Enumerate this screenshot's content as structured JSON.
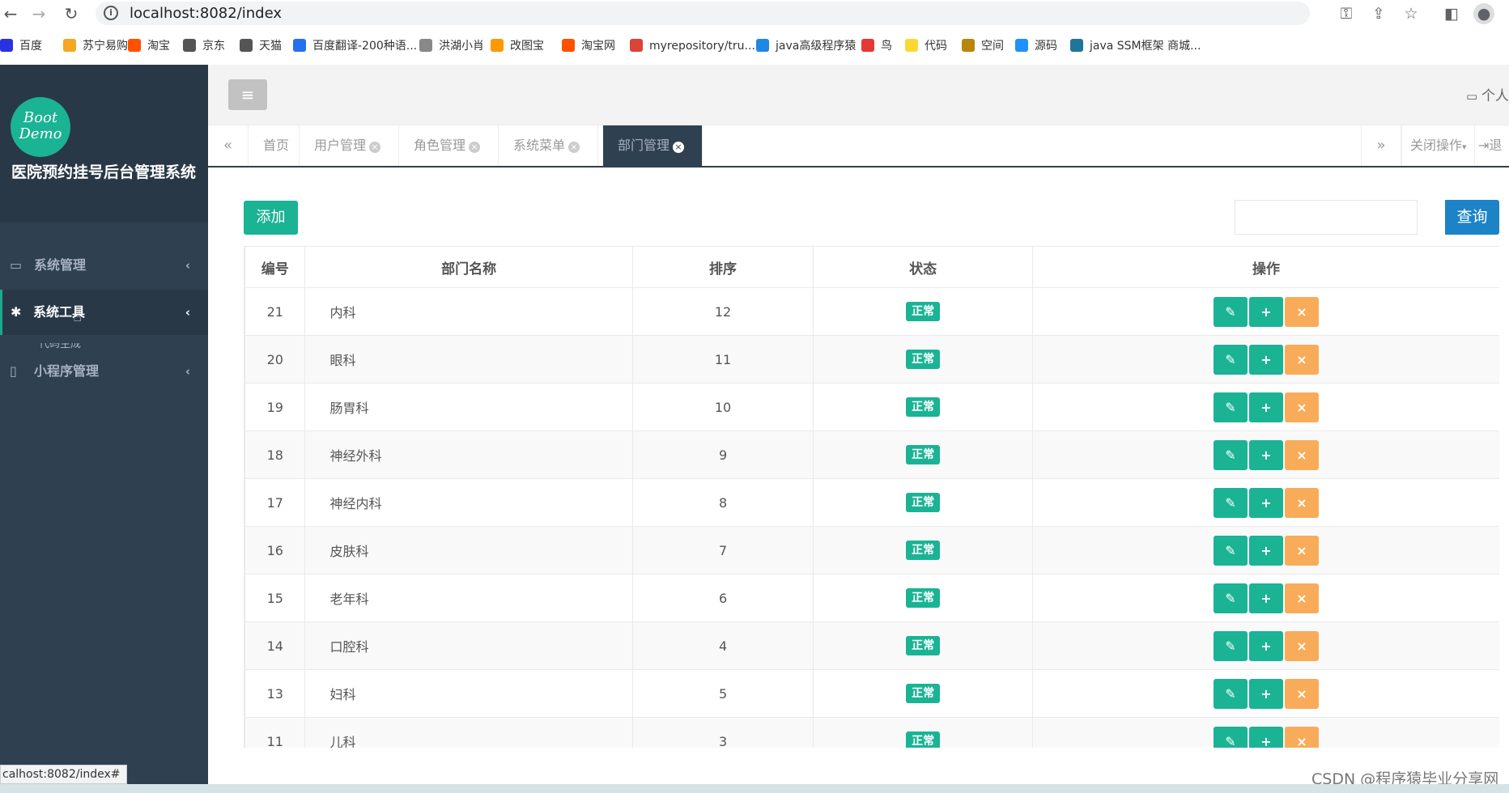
{
  "browser": {
    "url": "localhost:8082/index",
    "bookmarks": [
      "百度",
      "苏宁易购",
      "淘宝",
      "京东",
      "天猫",
      "百度翻译-200种语...",
      "洪湖小肖",
      "改图宝",
      "淘宝网",
      "myrepository/tru...",
      "java高级程序猿",
      "鸟",
      "代码",
      "空间",
      "源码",
      "java SSM框架 商城..."
    ],
    "bookmark_colors": [
      "#2932e1",
      "#f5a623",
      "#ff5000",
      "#555555",
      "#555555",
      "#2470ed",
      "#888888",
      "#ff9900",
      "#ff5000",
      "#db4437",
      "#1e88e5",
      "#e53935",
      "#fdd835",
      "#b8860b",
      "#1e90ff",
      "#21759b"
    ],
    "status_url": "calhost:8082/index#"
  },
  "sidebar": {
    "logo_text": "Boot Demo",
    "title": "医院预约挂号后台管理系统",
    "items": [
      {
        "label": "系统管理",
        "icon": "monitor-icon"
      },
      {
        "label": "系统工具",
        "icon": "gear-icon"
      },
      {
        "label": "小程序管理",
        "icon": "map-icon"
      }
    ],
    "submenu_peek": "代码生成"
  },
  "header": {
    "personal": "个人"
  },
  "tabs": {
    "items": [
      {
        "label": "首页"
      },
      {
        "label": "用户管理"
      },
      {
        "label": "角色管理"
      },
      {
        "label": "系统菜单"
      },
      {
        "label": "部门管理"
      }
    ],
    "close_ops": "关闭操作",
    "logout": "退"
  },
  "toolbar": {
    "add_label": "添加",
    "search_placeholder": "",
    "search_label": "查询"
  },
  "table": {
    "columns": [
      "编号",
      "部门名称",
      "排序",
      "状态",
      "操作"
    ],
    "rows": [
      {
        "id": "21",
        "name": "内科",
        "order": "12",
        "status": "正常"
      },
      {
        "id": "20",
        "name": "眼科",
        "order": "11",
        "status": "正常"
      },
      {
        "id": "19",
        "name": "肠胃科",
        "order": "10",
        "status": "正常"
      },
      {
        "id": "18",
        "name": "神经外科",
        "order": "9",
        "status": "正常"
      },
      {
        "id": "17",
        "name": "神经内科",
        "order": "8",
        "status": "正常"
      },
      {
        "id": "16",
        "name": "皮肤科",
        "order": "7",
        "status": "正常"
      },
      {
        "id": "15",
        "name": "老年科",
        "order": "6",
        "status": "正常"
      },
      {
        "id": "14",
        "name": "口腔科",
        "order": "4",
        "status": "正常"
      },
      {
        "id": "13",
        "name": "妇科",
        "order": "5",
        "status": "正常"
      },
      {
        "id": "11",
        "name": "儿科",
        "order": "3",
        "status": "正常"
      }
    ]
  },
  "watermark": "CSDN @程序猿毕业分享网",
  "colors": {
    "sidebar_bg": "#2f4050",
    "primary_green": "#1ab394",
    "search_blue": "#1c84c6",
    "delete_orange": "#f8ac59"
  }
}
